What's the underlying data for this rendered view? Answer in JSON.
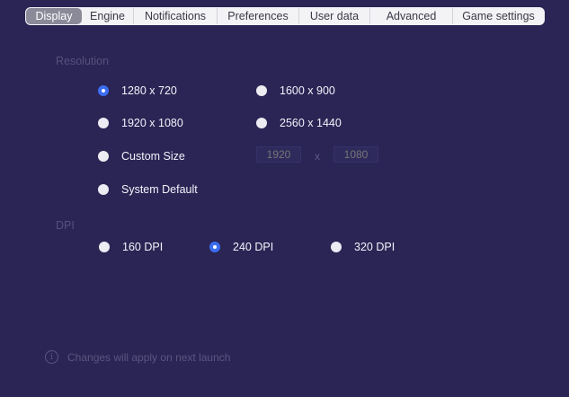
{
  "tabs": [
    {
      "label": "Display",
      "active": true
    },
    {
      "label": "Engine",
      "active": false
    },
    {
      "label": "Notifications",
      "active": false
    },
    {
      "label": "Preferences",
      "active": false
    },
    {
      "label": "User data",
      "active": false
    },
    {
      "label": "Advanced",
      "active": false
    },
    {
      "label": "Game settings",
      "active": false
    }
  ],
  "resolution": {
    "label": "Resolution",
    "options": [
      {
        "label": "1280 x 720",
        "checked": true
      },
      {
        "label": "1600 x 900",
        "checked": false
      },
      {
        "label": "1920 x 1080",
        "checked": false
      },
      {
        "label": "2560 x 1440",
        "checked": false
      },
      {
        "label": "Custom Size",
        "checked": false
      },
      {
        "label": "System Default",
        "checked": false
      }
    ],
    "custom_width_placeholder": "1920",
    "custom_height_placeholder": "1080",
    "times_symbol": "x"
  },
  "dpi": {
    "label": "DPI",
    "options": [
      {
        "label": "160 DPI",
        "checked": false
      },
      {
        "label": "240 DPI",
        "checked": true
      },
      {
        "label": "320 DPI",
        "checked": false
      }
    ]
  },
  "footer": {
    "icon": "info-icon",
    "text": "Changes will apply on next launch"
  },
  "colors": {
    "background": "#2a2554",
    "accent": "#3b6df0"
  }
}
